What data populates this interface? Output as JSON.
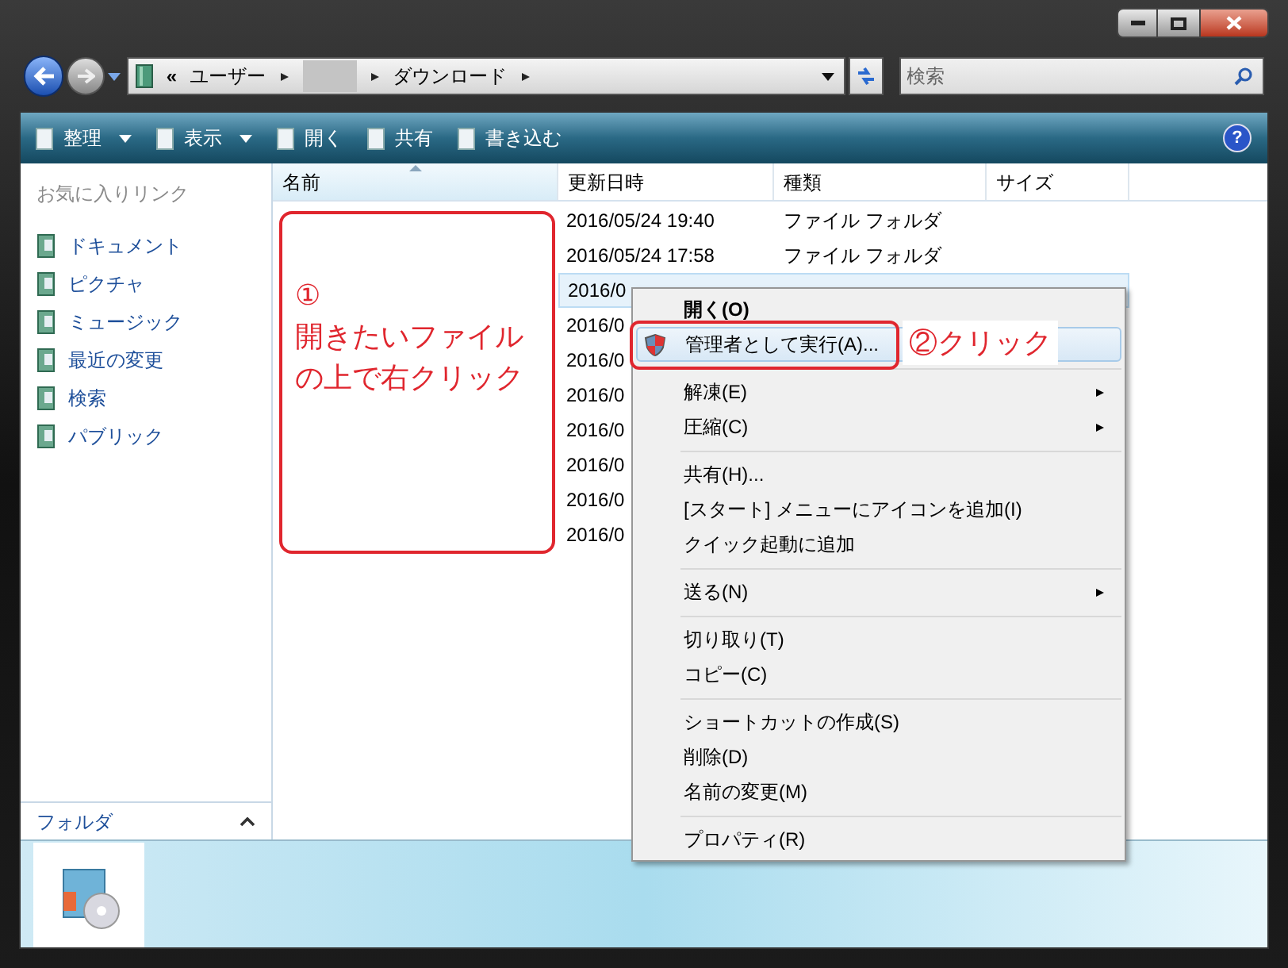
{
  "address_bar": {
    "overflow": "«",
    "crumbs": [
      {
        "kind": "text",
        "label": "ユーザー"
      },
      {
        "kind": "hidden"
      },
      {
        "kind": "text",
        "label": "ダウンロード"
      }
    ]
  },
  "search": {
    "placeholder": "検索"
  },
  "toolbar": [
    {
      "label": "整理",
      "dropdown": true
    },
    {
      "label": "表示",
      "dropdown": true
    },
    {
      "label": "開く",
      "dropdown": false
    },
    {
      "label": "共有",
      "dropdown": false
    },
    {
      "label": "書き込む",
      "dropdown": false
    }
  ],
  "help": {
    "glyph": "?"
  },
  "sidebar": {
    "heading": "お気に入りリンク",
    "items": [
      {
        "label": "ドキュメント"
      },
      {
        "label": "ピクチャ"
      },
      {
        "label": "ミュージック"
      },
      {
        "label": "最近の変更"
      },
      {
        "label": "検索"
      },
      {
        "label": "パブリック"
      }
    ],
    "footer": "フォルダ"
  },
  "table": {
    "columns": [
      {
        "label": "名前",
        "sorted": true
      },
      {
        "label": "更新日時",
        "sorted": false
      },
      {
        "label": "種類",
        "sorted": false
      },
      {
        "label": "サイズ",
        "sorted": false
      }
    ],
    "rows": [
      {
        "date": "2016/05/24 19:40",
        "type": "ファイル フォルダ",
        "selected": false
      },
      {
        "date": "2016/05/24 17:58",
        "type": "ファイル フォルダ",
        "selected": false
      },
      {
        "date": "2016/0",
        "selected": true
      },
      {
        "date": "2016/0",
        "selected": false
      },
      {
        "date": "2016/0",
        "selected": false
      },
      {
        "date": "2016/0",
        "selected": false
      },
      {
        "date": "2016/0",
        "selected": false
      },
      {
        "date": "2016/0",
        "selected": false
      },
      {
        "date": "2016/0",
        "selected": false
      },
      {
        "date": "2016/0",
        "selected": false
      }
    ]
  },
  "context_menu": {
    "items": [
      {
        "kind": "item",
        "label": "開く(O)",
        "bold": true,
        "submenu": false,
        "highlighted": false
      },
      {
        "kind": "item",
        "label": "管理者として実行(A)...",
        "bold": false,
        "submenu": false,
        "highlighted": true,
        "shield": true
      },
      {
        "kind": "separator"
      },
      {
        "kind": "item",
        "label": "解凍(E)",
        "bold": false,
        "submenu": true,
        "highlighted": false
      },
      {
        "kind": "item",
        "label": "圧縮(C)",
        "bold": false,
        "submenu": true,
        "highlighted": false
      },
      {
        "kind": "separator"
      },
      {
        "kind": "item",
        "label": "共有(H)...",
        "bold": false,
        "submenu": false,
        "highlighted": false
      },
      {
        "kind": "item",
        "label": "[スタート] メニューにアイコンを追加(I)",
        "bold": false,
        "submenu": false,
        "highlighted": false
      },
      {
        "kind": "item",
        "label": "クイック起動に追加",
        "bold": false,
        "submenu": false,
        "highlighted": false
      },
      {
        "kind": "separator"
      },
      {
        "kind": "item",
        "label": "送る(N)",
        "bold": false,
        "submenu": true,
        "highlighted": false
      },
      {
        "kind": "separator"
      },
      {
        "kind": "item",
        "label": "切り取り(T)",
        "bold": false,
        "submenu": false,
        "highlighted": false
      },
      {
        "kind": "item",
        "label": "コピー(C)",
        "bold": false,
        "submenu": false,
        "highlighted": false
      },
      {
        "kind": "separator"
      },
      {
        "kind": "item",
        "label": "ショートカットの作成(S)",
        "bold": false,
        "submenu": false,
        "highlighted": false
      },
      {
        "kind": "item",
        "label": "削除(D)",
        "bold": false,
        "submenu": false,
        "highlighted": false
      },
      {
        "kind": "item",
        "label": "名前の変更(M)",
        "bold": false,
        "submenu": false,
        "highlighted": false
      },
      {
        "kind": "separator"
      },
      {
        "kind": "item",
        "label": "プロパティ(R)",
        "bold": false,
        "submenu": false,
        "highlighted": false
      }
    ]
  },
  "annotations": {
    "step1": [
      "①",
      "開きたいファイル",
      "の上で右クリック"
    ],
    "step2": "②クリック"
  }
}
